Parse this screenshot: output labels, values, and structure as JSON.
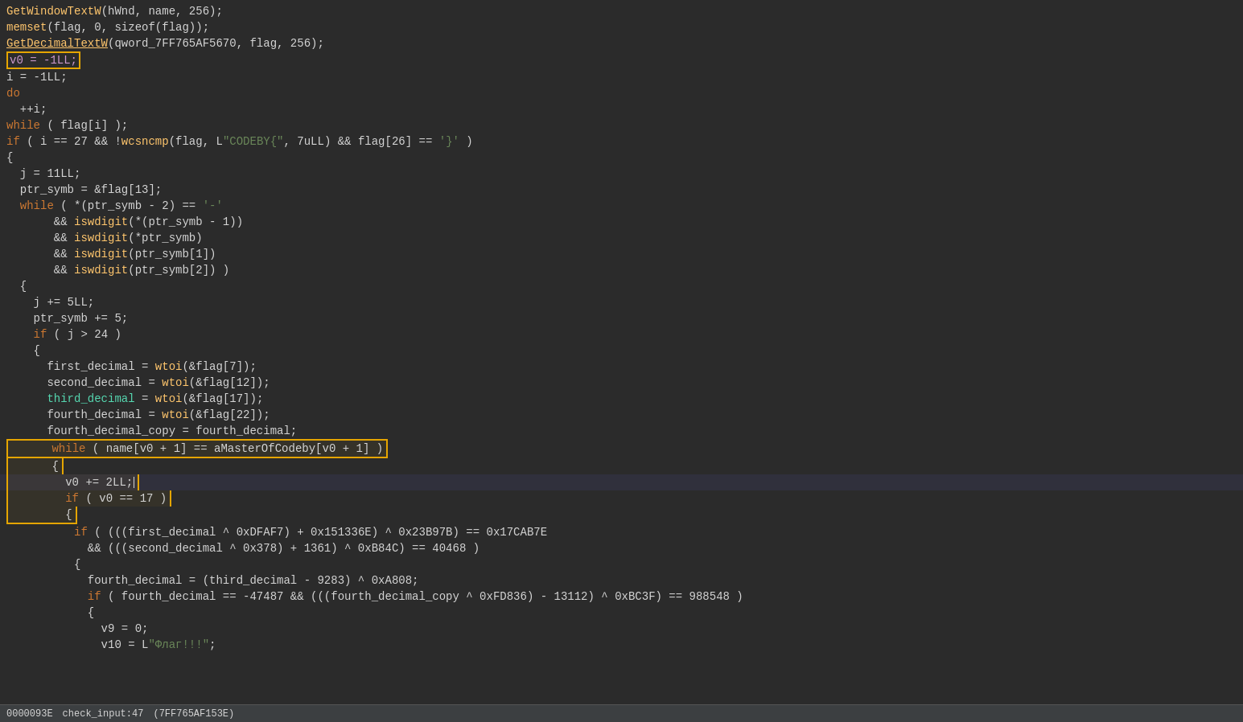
{
  "statusBar": {
    "address": "0000093E",
    "funcName": "check_input:47",
    "offset": "(7FF765AF153E)"
  },
  "lines": [
    {
      "id": 1,
      "tokens": [
        {
          "t": "fn",
          "v": "GetWindowTextW"
        },
        {
          "t": "op",
          "v": "(hWnd, name, 256);"
        }
      ]
    },
    {
      "id": 2,
      "tokens": [
        {
          "t": "fn",
          "v": "memset"
        },
        {
          "t": "op",
          "v": "(flag, 0, sizeof(flag));"
        }
      ]
    },
    {
      "id": 3,
      "tokens": [
        {
          "t": "fn",
          "v": "GetDecimalTextW"
        },
        {
          "t": "op",
          "v": "(qword_7FF765AF5670, flag, 256);"
        }
      ],
      "underline": true
    },
    {
      "id": 4,
      "tokens": [
        {
          "t": "v0box",
          "v": "v0 = -1LL;"
        }
      ]
    },
    {
      "id": 5,
      "tokens": [
        {
          "t": "op",
          "v": "i = -1LL;"
        }
      ]
    },
    {
      "id": 6,
      "tokens": [
        {
          "t": "kw",
          "v": "do"
        }
      ]
    },
    {
      "id": 7,
      "tokens": [
        {
          "t": "op",
          "v": "  "
        },
        {
          "t": "op",
          "v": "++i;"
        }
      ]
    },
    {
      "id": 8,
      "tokens": [
        {
          "t": "kw",
          "v": "while"
        },
        {
          "t": "op",
          "v": " ( flag[i] );"
        }
      ]
    },
    {
      "id": 9,
      "tokens": [
        {
          "t": "kw",
          "v": "if"
        },
        {
          "t": "op",
          "v": " ( i == 27 && !"
        },
        {
          "t": "fn",
          "v": "wcsncmp"
        },
        {
          "t": "op",
          "v": "(flag, L"
        },
        {
          "t": "str",
          "v": "\"CODEBY{\""
        },
        {
          "t": "op",
          "v": ", 7uLL) && flag[26] == "
        },
        {
          "t": "str",
          "v": "'}'"
        },
        {
          "t": "op",
          "v": " )"
        }
      ]
    },
    {
      "id": 10,
      "tokens": [
        {
          "t": "op",
          "v": "{"
        }
      ]
    },
    {
      "id": 11,
      "tokens": [
        {
          "t": "op",
          "v": "  j = 11LL;"
        }
      ]
    },
    {
      "id": 12,
      "tokens": [
        {
          "t": "op",
          "v": "  ptr_symb = &flag[13];"
        }
      ]
    },
    {
      "id": 13,
      "tokens": [
        {
          "t": "kw",
          "v": "  while"
        },
        {
          "t": "op",
          "v": " ( *(ptr_symb - 2) == "
        },
        {
          "t": "str",
          "v": "'-'"
        }
      ]
    },
    {
      "id": 14,
      "tokens": [
        {
          "t": "op",
          "v": "       && "
        },
        {
          "t": "fn",
          "v": "iswdigit"
        },
        {
          "t": "op",
          "v": "(*(ptr_symb - 1))"
        }
      ]
    },
    {
      "id": 15,
      "tokens": [
        {
          "t": "op",
          "v": "       && "
        },
        {
          "t": "fn",
          "v": "iswdigit"
        },
        {
          "t": "op",
          "v": "(*ptr_symb)"
        }
      ]
    },
    {
      "id": 16,
      "tokens": [
        {
          "t": "op",
          "v": "       && "
        },
        {
          "t": "fn",
          "v": "iswdigit"
        },
        {
          "t": "op",
          "v": "(ptr_symb[1])"
        }
      ]
    },
    {
      "id": 17,
      "tokens": [
        {
          "t": "op",
          "v": "       && "
        },
        {
          "t": "fn",
          "v": "iswdigit"
        },
        {
          "t": "op",
          "v": "(ptr_symb[2]) )"
        }
      ]
    },
    {
      "id": 18,
      "tokens": [
        {
          "t": "op",
          "v": "  {"
        }
      ]
    },
    {
      "id": 19,
      "tokens": [
        {
          "t": "op",
          "v": "    j += 5LL;"
        }
      ]
    },
    {
      "id": 20,
      "tokens": [
        {
          "t": "op",
          "v": "    ptr_symb += 5;"
        }
      ]
    },
    {
      "id": 21,
      "tokens": [
        {
          "t": "kw",
          "v": "    if"
        },
        {
          "t": "op",
          "v": " ( j > 24 )"
        }
      ]
    },
    {
      "id": 22,
      "tokens": [
        {
          "t": "op",
          "v": "    {"
        }
      ]
    },
    {
      "id": 23,
      "tokens": [
        {
          "t": "op",
          "v": "      first_decimal = "
        },
        {
          "t": "fn",
          "v": "wtoi"
        },
        {
          "t": "op",
          "v": "(&flag[7]);"
        }
      ]
    },
    {
      "id": 24,
      "tokens": [
        {
          "t": "op",
          "v": "      second_decimal = "
        },
        {
          "t": "fn",
          "v": "wtoi"
        },
        {
          "t": "op",
          "v": "(&flag[12]);"
        }
      ]
    },
    {
      "id": 25,
      "tokens": [
        {
          "t": "cyan",
          "v": "      third_decimal"
        },
        {
          "t": "op",
          "v": " = "
        },
        {
          "t": "fn",
          "v": "wtoi"
        },
        {
          "t": "op",
          "v": "(&flag[17]);"
        }
      ]
    },
    {
      "id": 26,
      "tokens": [
        {
          "t": "op",
          "v": "      fourth_decimal = "
        },
        {
          "t": "fn",
          "v": "wtoi"
        },
        {
          "t": "op",
          "v": "(&flag[22]);"
        }
      ]
    },
    {
      "id": 27,
      "tokens": [
        {
          "t": "op",
          "v": "      fourth_decimal_copy = fourth_decimal;"
        }
      ]
    },
    {
      "id": 28,
      "tokens": [
        {
          "t": "whilebox",
          "v": "      while ( name[v0 + 1] == aMasterOfCodeby[v0 + 1] )"
        }
      ]
    },
    {
      "id": 29,
      "tokens": [
        {
          "t": "whilebox2",
          "v": "      {"
        }
      ]
    },
    {
      "id": 30,
      "tokens": [
        {
          "t": "whilebox2",
          "v": "        v0 += 2LL;"
        }
      ]
    },
    {
      "id": 31,
      "tokens": [
        {
          "t": "whilebox2",
          "v": "        if ( v0 == 17 )"
        }
      ]
    },
    {
      "id": 32,
      "tokens": [
        {
          "t": "whilebox2",
          "v": "        {"
        }
      ]
    },
    {
      "id": 33,
      "tokens": [
        {
          "t": "op",
          "v": "          "
        },
        {
          "t": "kw",
          "v": "if"
        },
        {
          "t": "op",
          "v": " ( (((first_decimal ^ 0xDFAF7) + 0x151336E) ^ 0x23B97B) == 0x17CAB7E"
        }
      ]
    },
    {
      "id": 34,
      "tokens": [
        {
          "t": "op",
          "v": "            && (((second_decimal ^ 0x378) + 1361) ^ 0xB84C) == 40468 )"
        }
      ]
    },
    {
      "id": 35,
      "tokens": [
        {
          "t": "op",
          "v": "          {"
        }
      ]
    },
    {
      "id": 36,
      "tokens": [
        {
          "t": "op",
          "v": "            fourth_decimal = (third_decimal - 9283) ^ 0xA808;"
        }
      ]
    },
    {
      "id": 37,
      "tokens": [
        {
          "t": "op",
          "v": "            "
        },
        {
          "t": "kw",
          "v": "if"
        },
        {
          "t": "op",
          "v": " ( fourth_decimal == -47487 && (((fourth_decimal_copy ^ 0xFD836) - 13112) ^ 0xBC3F) == 988548 )"
        }
      ]
    },
    {
      "id": 38,
      "tokens": [
        {
          "t": "op",
          "v": "            {"
        }
      ]
    },
    {
      "id": 39,
      "tokens": [
        {
          "t": "op",
          "v": "              v9 = 0;"
        }
      ]
    },
    {
      "id": 40,
      "tokens": [
        {
          "t": "op",
          "v": "              v10 = L"
        },
        {
          "t": "str",
          "v": "\"Флаг!!!\""
        },
        {
          "t": "op",
          "v": ";"
        }
      ]
    }
  ]
}
